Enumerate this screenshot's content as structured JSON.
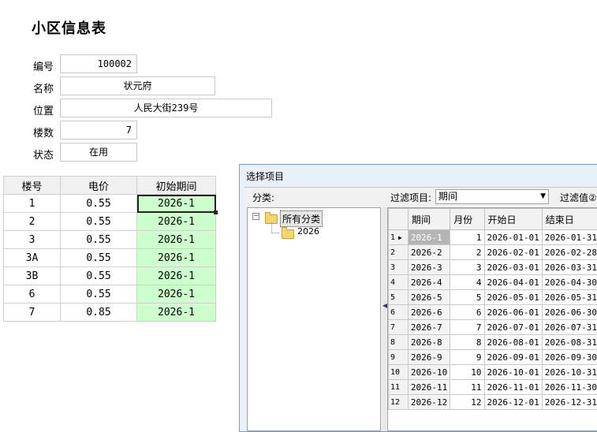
{
  "page_title": "小区信息表",
  "fields": [
    {
      "label": "编号",
      "value": "100002"
    },
    {
      "label": "名称",
      "value": "状元府"
    },
    {
      "label": "位置",
      "value": "人民大街239号"
    },
    {
      "label": "楼数",
      "value": "7"
    },
    {
      "label": "状态",
      "value": "在用"
    }
  ],
  "floor_table": {
    "headers": [
      "楼号",
      "电价",
      "初始期间"
    ],
    "rows": [
      [
        "1",
        "0.55",
        "2026-1"
      ],
      [
        "2",
        "0.55",
        "2026-1"
      ],
      [
        "3",
        "0.55",
        "2026-1"
      ],
      [
        "3A",
        "0.55",
        "2026-1"
      ],
      [
        "3B",
        "0.55",
        "2026-1"
      ],
      [
        "6",
        "0.55",
        "2026-1"
      ],
      [
        "7",
        "0.85",
        "2026-1"
      ]
    ]
  },
  "dialog": {
    "title": "选择项目",
    "category_label": "分类:",
    "filter_item_label": "过滤项目:",
    "filter_item_value": "期间",
    "filter_value_label": "过滤值②",
    "tree": {
      "root": "所有分类",
      "child": "2026"
    },
    "grid": {
      "headers": [
        "期间",
        "月份",
        "开始日",
        "结束日"
      ],
      "rows": [
        [
          "1",
          "2026-1",
          "1",
          "2026-01-01",
          "2026-01-31"
        ],
        [
          "2",
          "2026-2",
          "2",
          "2026-02-01",
          "2026-02-28"
        ],
        [
          "3",
          "2026-3",
          "3",
          "2026-03-01",
          "2026-03-31"
        ],
        [
          "4",
          "2026-4",
          "4",
          "2026-04-01",
          "2026-04-30"
        ],
        [
          "5",
          "2026-5",
          "5",
          "2026-05-01",
          "2026-05-31"
        ],
        [
          "6",
          "2026-6",
          "6",
          "2026-06-01",
          "2026-06-30"
        ],
        [
          "7",
          "2026-7",
          "7",
          "2026-07-01",
          "2026-07-31"
        ],
        [
          "8",
          "2026-8",
          "8",
          "2026-08-01",
          "2026-08-31"
        ],
        [
          "9",
          "2026-9",
          "9",
          "2026-09-01",
          "2026-09-30"
        ],
        [
          "10",
          "2026-10",
          "10",
          "2026-10-01",
          "2026-10-31"
        ],
        [
          "11",
          "2026-11",
          "11",
          "2026-11-01",
          "2026-11-30"
        ],
        [
          "12",
          "2026-12",
          "12",
          "2026-12-01",
          "2026-12-31"
        ]
      ]
    }
  }
}
